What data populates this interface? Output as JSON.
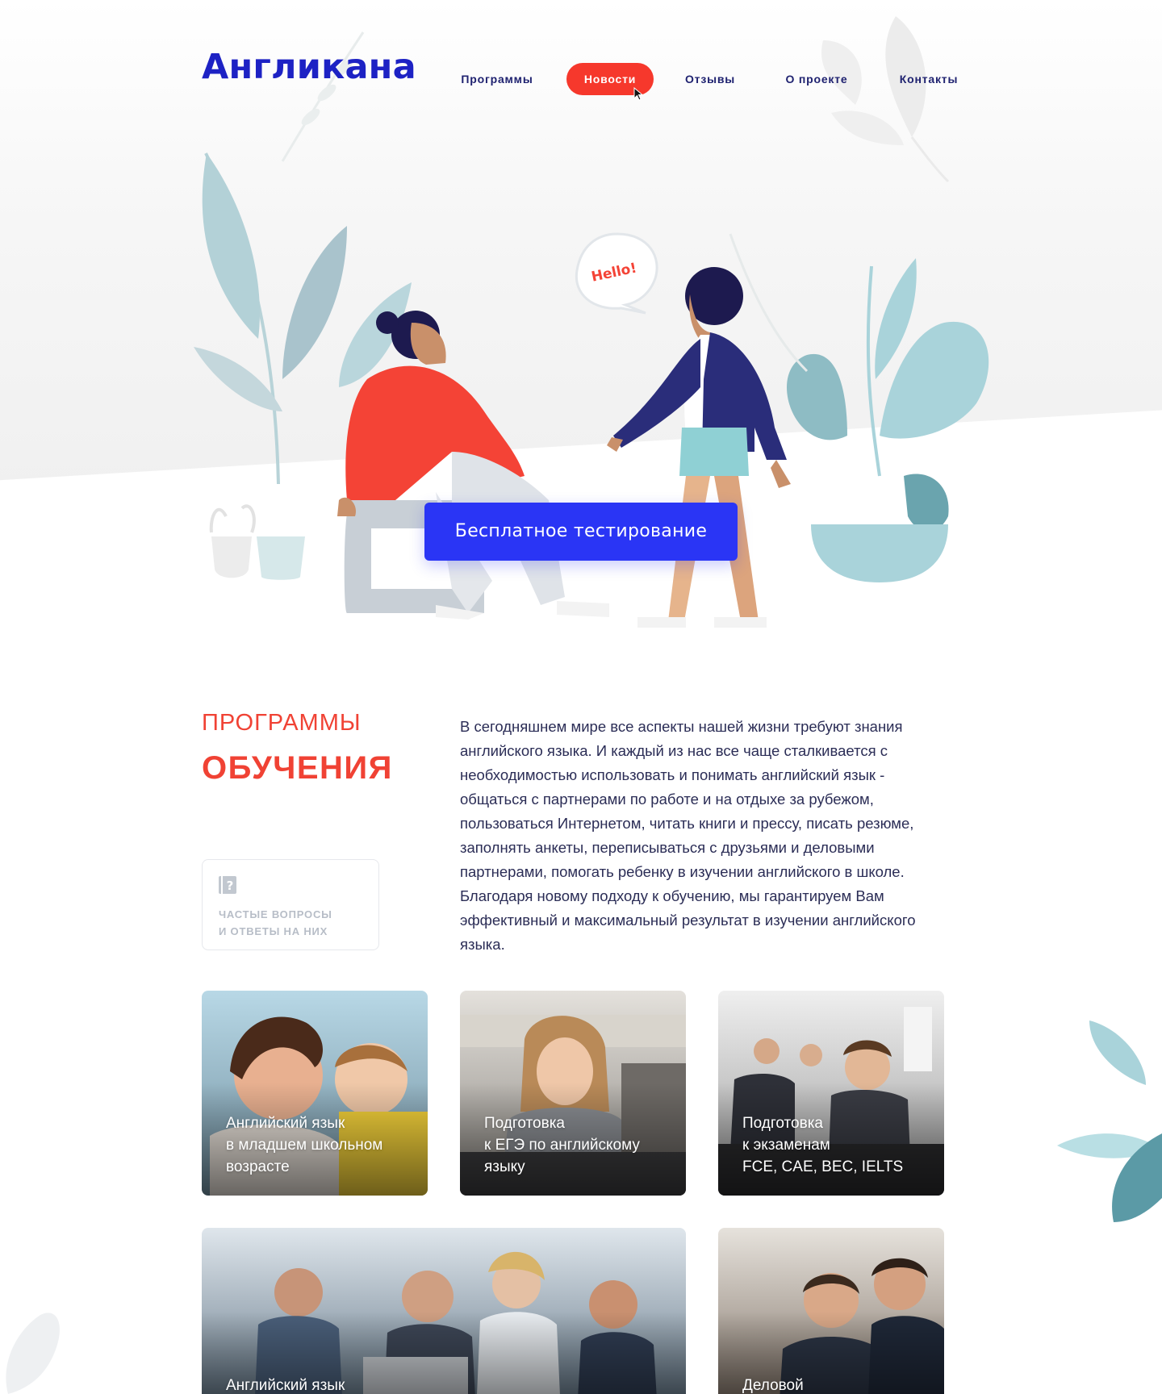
{
  "brand": {
    "logo": "Англикана"
  },
  "nav": {
    "items": [
      {
        "label": "Программы",
        "active": false
      },
      {
        "label": "Новости",
        "active": true
      },
      {
        "label": "Отзывы",
        "active": false
      },
      {
        "label": "О проекте",
        "active": false
      },
      {
        "label": "Контакты",
        "active": false
      }
    ]
  },
  "hero": {
    "speech_bubble": "Hello!",
    "cta_label": "Бесплатное тестирование"
  },
  "programs": {
    "eyebrow": "ПРОГРАММЫ",
    "title": "ОБУЧЕНИЯ",
    "faq": {
      "icon": "question-book-icon",
      "line1": "ЧАСТЫЕ ВОПРОСЫ",
      "line2": "И ОТВЕТЫ НА НИХ"
    },
    "description": "В сегодняшнем мире все аспекты нашей жизни требуют знания английского языка. И каждый из нас все чаще сталкивается с необходимостью использовать и понимать английский язык - общаться с партнерами по работе и на отдыхе за рубежом, пользоваться Интернетом, читать книги и прессу, писать резюме, заполнять анкеты, переписываться с друзьями и деловыми партнерами, помогать ребенку в изучении английского в школе. Благодаря новому подходу к обучению, мы гарантируем Вам эффективный и максимальный результат в изучении английского языка.",
    "cards": [
      {
        "label": "Английский язык\nв младшем школьном\nвозрасте"
      },
      {
        "label": "Подготовка\nк ЕГЭ по английскому\nязыку"
      },
      {
        "label": "Подготовка\nк экзаменам\nFCE, CAE, BEC, IELTS"
      },
      {
        "label": "Английский язык"
      },
      {
        "label": "Деловой"
      }
    ]
  },
  "colors": {
    "brand_blue": "#1d22c4",
    "accent_red": "#f6382c",
    "cta_blue": "#2a35f5",
    "plant_teal": "#a9d3da"
  }
}
